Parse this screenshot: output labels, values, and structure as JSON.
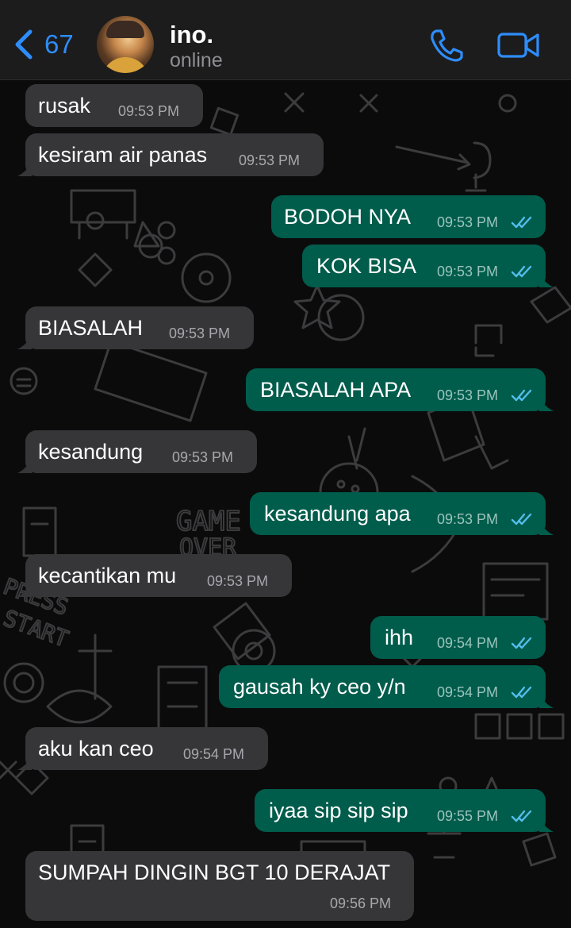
{
  "header": {
    "back_count": "67",
    "contact_name": "ino.",
    "status": "online"
  },
  "colors": {
    "incoming_bubble": "#363638",
    "outgoing_bubble": "#005c4b",
    "accent": "#2e8dfb",
    "read_tick": "#53bdeb"
  },
  "icons": {
    "back": "chevron-left-icon",
    "call": "phone-icon",
    "video": "video-camera-icon",
    "read_receipt": "double-check-icon"
  },
  "messages": [
    {
      "dir": "in",
      "text": "rusak",
      "time": "09:53 PM"
    },
    {
      "dir": "in",
      "text": "kesiram air panas",
      "time": "09:53 PM"
    },
    {
      "dir": "out",
      "text": "BODOH NYA",
      "time": "09:53 PM",
      "read": true
    },
    {
      "dir": "out",
      "text": "KOK BISA",
      "time": "09:53 PM",
      "read": true
    },
    {
      "dir": "in",
      "text": "BIASALAH",
      "time": "09:53 PM"
    },
    {
      "dir": "out",
      "text": "BIASALAH APA",
      "time": "09:53 PM",
      "read": true
    },
    {
      "dir": "in",
      "text": "kesandung",
      "time": "09:53 PM"
    },
    {
      "dir": "out",
      "text": "kesandung apa",
      "time": "09:53 PM",
      "read": true
    },
    {
      "dir": "in",
      "text": "kecantikan mu",
      "time": "09:53 PM"
    },
    {
      "dir": "out",
      "text": "ihh",
      "time": "09:54 PM",
      "read": true
    },
    {
      "dir": "out",
      "text": "gausah ky ceo y/n",
      "time": "09:54 PM",
      "read": true
    },
    {
      "dir": "in",
      "text": "aku kan ceo",
      "time": "09:54 PM"
    },
    {
      "dir": "out",
      "text": "iyaa sip sip sip",
      "time": "09:55 PM",
      "read": true
    },
    {
      "dir": "in",
      "text": "SUMPAH DINGIN BGT 10 DERAJAT",
      "time": "09:56 PM"
    }
  ]
}
